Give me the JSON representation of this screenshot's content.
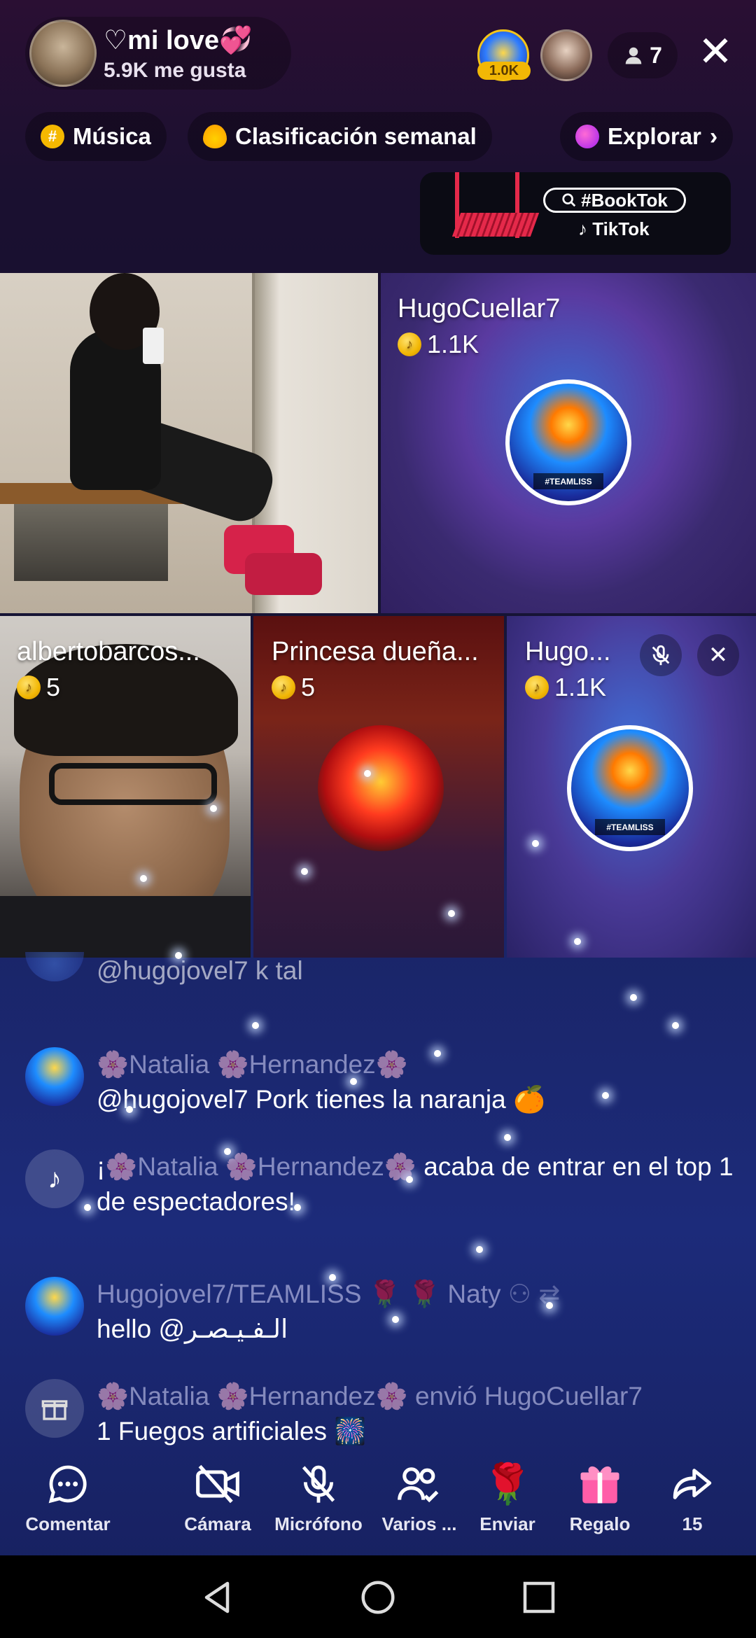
{
  "host": {
    "name": "♡mi love💞",
    "likes": "5.9K me gusta"
  },
  "top_viewers": {
    "first_badge": "1.0K",
    "viewer_count": "7"
  },
  "categories": [
    {
      "label": "Música"
    },
    {
      "label": "Clasificación semanal"
    },
    {
      "label": "Explorar"
    }
  ],
  "banner": {
    "tag": "#BookTok",
    "brand": "TikTok"
  },
  "guests": [
    {
      "name": "HugoCuellar7",
      "coins": "1.1K",
      "avatar_caption": "#TEAMLISS"
    },
    {
      "name": "albertobarcos...",
      "coins": "5"
    },
    {
      "name": "Princesa dueña...",
      "coins": "5"
    },
    {
      "name": "Hugo...",
      "coins": "1.1K",
      "avatar_caption": "#TEAMLISS"
    }
  ],
  "chat": [
    {
      "type": "comment",
      "name": "",
      "text": "@hugojovel7 k tal"
    },
    {
      "type": "comment",
      "name": "🌸Natalia 🌸Hernandez🌸",
      "text": "@hugojovel7 Pork tienes la naranja 🍊"
    },
    {
      "type": "system",
      "prefix": "¡",
      "name": "🌸Natalia 🌸Hernandez🌸",
      "text": " acaba de entrar en el top 1 de espectadores!"
    },
    {
      "type": "comment",
      "name": "Hugojovel7/TEAMLISS 🌹 🌹 Naty",
      "text": "hello @الـفـيـصـر"
    },
    {
      "type": "gift",
      "name": "🌸Natalia 🌸Hernandez🌸",
      "text_mid": " envió ",
      "recipient": "HugoCuellar7",
      "text": "1 Fuegos artificiales 🎆"
    }
  ],
  "toolbar": {
    "comment": "Comentar",
    "camera": "Cámara",
    "mic": "Micrófono",
    "multi": "Varios ...",
    "send": "Enviar",
    "gift": "Regalo",
    "share": "15"
  },
  "colors": {
    "accent_gold": "#f2b705",
    "book_red": "#e5294a"
  }
}
